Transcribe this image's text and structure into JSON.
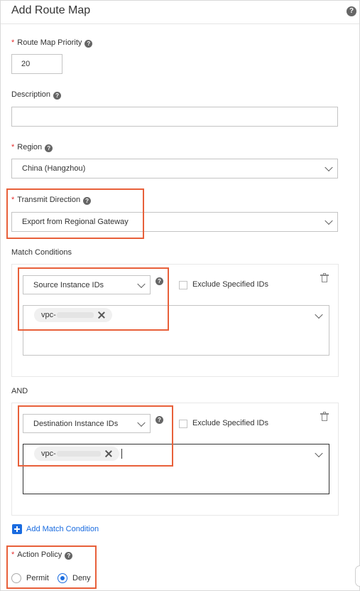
{
  "colors": {
    "accent": "#1a6ce0",
    "required": "#e62e2e",
    "highlight": "#e8603a",
    "border": "#c4c4c4"
  },
  "panel": {
    "title": "Add Route Map",
    "help_icon": "question-circle-icon"
  },
  "fields": {
    "priority": {
      "label": "Route Map Priority",
      "value": "20",
      "required_mark": "*"
    },
    "description": {
      "label": "Description",
      "value": ""
    },
    "region": {
      "label": "Region",
      "value": "China (Hangzhou)",
      "required_mark": "*"
    },
    "direction": {
      "label": "Transmit Direction",
      "value": "Export from Regional Gateway",
      "required_mark": "*"
    }
  },
  "match": {
    "label": "Match Conditions",
    "joiner": "AND",
    "conditions": [
      {
        "type": "Source Instance IDs",
        "exclude_label": "Exclude Specified IDs",
        "exclude_checked": false,
        "tag_prefix": "vpc-"
      },
      {
        "type": "Destination Instance IDs",
        "exclude_label": "Exclude Specified IDs",
        "exclude_checked": false,
        "tag_prefix": "vpc-"
      }
    ],
    "add_label": "Add Match Condition"
  },
  "action": {
    "label": "Action Policy",
    "required_mark": "*",
    "options": [
      "Permit",
      "Deny"
    ],
    "selected": "Deny"
  }
}
